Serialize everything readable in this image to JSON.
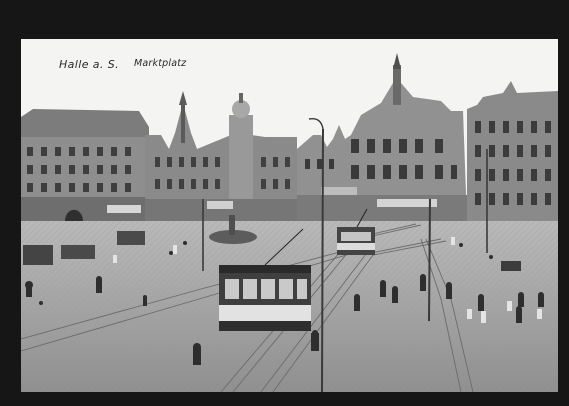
{
  "postcard": {
    "caption_city": "Halle a. S.",
    "caption_place": "Marktplatz"
  },
  "colors": {
    "border": "#161616",
    "sky": "#f4f4f2",
    "square": "#a9a9a9",
    "buildings": "#8c8c8c"
  }
}
